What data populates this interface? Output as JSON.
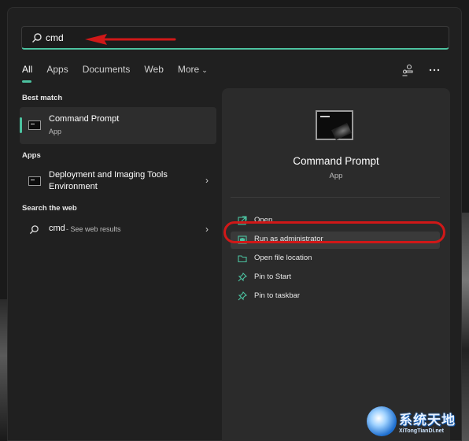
{
  "search": {
    "value": "cmd"
  },
  "tabs": [
    {
      "label": "All"
    },
    {
      "label": "Apps"
    },
    {
      "label": "Documents"
    },
    {
      "label": "Web"
    },
    {
      "label": "More"
    }
  ],
  "tab_icons": [
    "people-share-icon",
    "more-ellipsis-icon"
  ],
  "sections": {
    "best_match": "Best match",
    "apps": "Apps",
    "web": "Search the web"
  },
  "best_match": {
    "title": "Command Prompt",
    "subtitle": "App",
    "icon": "cmd-icon"
  },
  "apps": [
    {
      "title_line1": "Deployment and Imaging Tools",
      "title_line2": "Environment",
      "icon": "cmd-icon"
    }
  ],
  "web": [
    {
      "query": "cmd",
      "suffix": "- See web results",
      "icon": "search-icon"
    }
  ],
  "detail": {
    "title": "Command Prompt",
    "subtitle": "App",
    "actions": [
      {
        "label": "Open",
        "icon": "open-external-icon"
      },
      {
        "label": "Run as administrator",
        "icon": "shield-admin-icon"
      },
      {
        "label": "Open file location",
        "icon": "folder-icon"
      },
      {
        "label": "Pin to Start",
        "icon": "pin-icon"
      },
      {
        "label": "Pin to taskbar",
        "icon": "pin-icon"
      }
    ]
  },
  "watermark": {
    "cn": "系统天地",
    "en": "XiTongTianDi.net"
  },
  "colors": {
    "accent": "#4cc2a0",
    "annotation": "#d01818",
    "panel": "#202020",
    "pane": "#2b2b2b"
  }
}
